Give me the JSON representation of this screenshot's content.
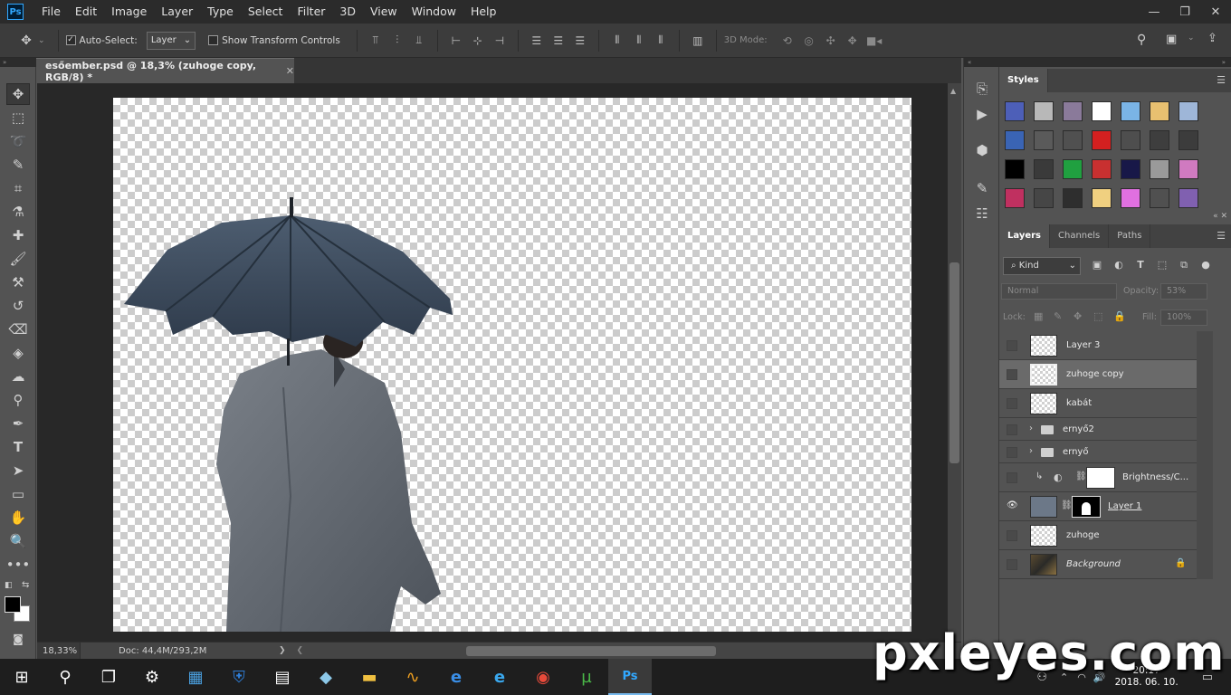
{
  "menubar": {
    "logo": "Ps",
    "items": [
      "File",
      "Edit",
      "Image",
      "Layer",
      "Type",
      "Select",
      "Filter",
      "3D",
      "View",
      "Window",
      "Help"
    ],
    "window_controls": [
      "—",
      "❐",
      "✕"
    ]
  },
  "options_bar": {
    "auto_select_label": "Auto-Select:",
    "auto_select_target": "Layer",
    "show_transform_label": "Show Transform Controls",
    "mode_3d_label": "3D Mode:"
  },
  "document_tab": {
    "title": "esőember.psd @ 18,3% (zuhoge copy, RGB/8) *",
    "close": "✕"
  },
  "statusbar": {
    "zoom": "18,33%",
    "doc_size": "Doc: 44,4M/293,2M",
    "arrow": "❯"
  },
  "styles_panel": {
    "tab": "Styles",
    "swatch_colors": [
      "#4d5fb8",
      "#b8b8b8",
      "#8a7a9a",
      "#ffffff",
      "#7ab4e6",
      "#e8c070",
      "#9eb6d8",
      "#3a64b4",
      "#5a5a5a",
      "#505050",
      "#d42020",
      "#4e4e4e",
      "#3e3e3e",
      "#3c3c3c",
      "#000000",
      "#3a3a3a",
      "#20a040",
      "#c83030",
      "#181848",
      "#9a9a9a",
      "#d07ac0",
      "#c03060",
      "#464646",
      "#2e2e2e",
      "#f0d080",
      "#e070e0",
      "#505050",
      "#8060b0"
    ]
  },
  "layers_panel": {
    "tabs": [
      "Layers",
      "Channels",
      "Paths"
    ],
    "filter_kind": "Kind",
    "blend_mode": "Normal",
    "opacity_label": "Opacity:",
    "opacity_value": "53%",
    "lock_label": "Lock:",
    "fill_label": "Fill:",
    "fill_value": "100%",
    "layers": [
      {
        "name": "Layer 3",
        "visible": false,
        "selected": false
      },
      {
        "name": "zuhoge copy",
        "visible": false,
        "selected": true
      },
      {
        "name": "kabát",
        "visible": false,
        "selected": false
      },
      {
        "name": "ernyő2",
        "visible": false,
        "selected": false,
        "group": true
      },
      {
        "name": "ernyő",
        "visible": false,
        "selected": false,
        "group": true
      },
      {
        "name": "Brightness/C...",
        "visible": false,
        "selected": false,
        "adjustment": true
      },
      {
        "name": "Layer 1",
        "visible": true,
        "selected": false
      },
      {
        "name": "zuhoge",
        "visible": false,
        "selected": false
      },
      {
        "name": "Background",
        "visible": false,
        "selected": false,
        "locked": true
      }
    ]
  },
  "taskbar": {
    "clock_time": "20:17",
    "clock_date": "2018. 06. 10."
  },
  "watermark": "pxleyes.com"
}
